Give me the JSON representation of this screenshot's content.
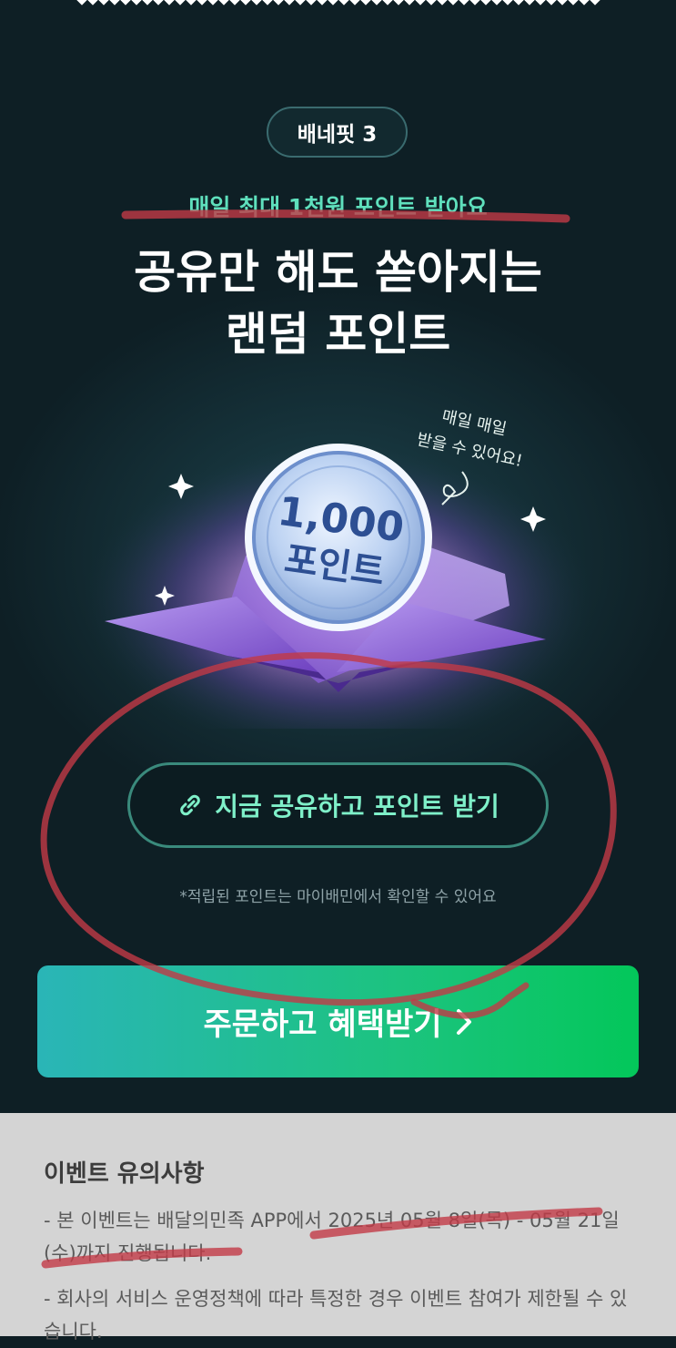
{
  "header": {
    "badge": "배네핏 3",
    "subtitle": "매일 최대 1천원 포인트 받아요",
    "title_line1": "공유만 해도 쏟아지는",
    "title_line2": "랜덤 포인트"
  },
  "illustration": {
    "coin_amount": "1,000",
    "coin_unit": "포인트",
    "handwriting_line1": "매일 매일",
    "handwriting_line2": "받을 수 있어요!"
  },
  "share": {
    "label": "지금 공유하고 포인트 받기",
    "icon": "link-icon",
    "note": "*적립된 포인트는 마이배민에서 확인할 수 있어요"
  },
  "order": {
    "label": "주문하고 혜택받기",
    "icon": "chevron-right-icon"
  },
  "notice": {
    "title": "이벤트 유의사항",
    "item1": "- 본 이벤트는 배달의민족 APP에서 2025년 05월 8일(목) - 05월 21일(수)까지 진행됩니다.",
    "item2": "- 회사의 서비스 운영정책에 따라 특정한 경우 이벤트 참여가 제한될 수 있습니다."
  },
  "colors": {
    "background": "#0e1e24",
    "accent_mint": "#5fe0bd",
    "order_gradient_start": "#2ab5b7",
    "order_gradient_end": "#03c75a",
    "annotation_red": "#c23a46"
  }
}
